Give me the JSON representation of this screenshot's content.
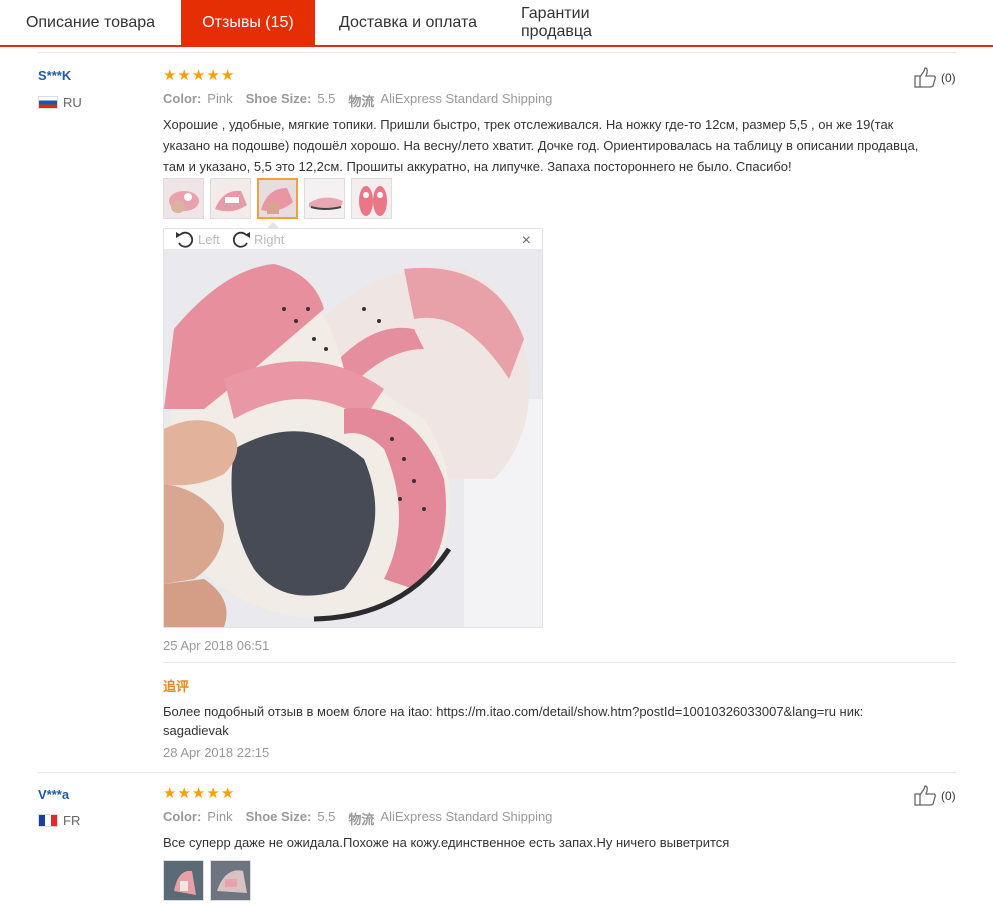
{
  "tabs": [
    {
      "label": "Описание товара"
    },
    {
      "label": "Отзывы (15)"
    },
    {
      "label": "Доставка и оплата"
    },
    {
      "label": "Гарантии продавца"
    }
  ],
  "reviews": [
    {
      "user": "S***K",
      "country": "RU",
      "helpful": "(0)",
      "meta": {
        "color_key": "Color:",
        "color_val": "Pink",
        "size_key": "Shoe Size:",
        "size_val": "5.5",
        "ship_key": "物流",
        "ship_val": "AliExpress Standard Shipping"
      },
      "text": "Хорошие , удобные, мягкие топики. Пришли быстро, трек отслеживался. На ножку где-то 12см, размер 5,5 , он же 19(так указано на подошве) подошёл хорошо. На весну/лето хватит. Дочке год. Ориентировалась на таблицу в описании продавца, там и указано, 5,5 это 12,2см. Прошиты аккуратно, на липучке. Запаха постороннего не было. Спасибо!",
      "viewer": {
        "left_label": "Left",
        "right_label": "Right",
        "close": "×"
      },
      "date": "25 Apr 2018 06:51",
      "followup": {
        "label": "追评",
        "text": "Более подобный отзыв в моем блоге на itao: https://m.itao.com/detail/show.htm?postId=10010326033007&lang=ru ник: sagadievak",
        "date": "28 Apr 2018 22:15"
      }
    },
    {
      "user": "V***a",
      "country": "FR",
      "helpful": "(0)",
      "meta": {
        "color_key": "Color:",
        "color_val": "Pink",
        "size_key": "Shoe Size:",
        "size_val": "5.5",
        "ship_key": "物流",
        "ship_val": "AliExpress Standard Shipping"
      },
      "text": "Все суперр даже не ожидала.Похоже на кожу.единственное есть запах.Ну ничего выветрится"
    }
  ],
  "colors": {
    "accent": "#e62e04",
    "star": "#f6a100",
    "link": "#1f5aa6",
    "followup": "#e88a1a"
  },
  "icons": [
    "star-icon",
    "thumbs-up-icon",
    "rotate-left-icon",
    "rotate-right-icon",
    "close-icon",
    "flag-icon"
  ]
}
